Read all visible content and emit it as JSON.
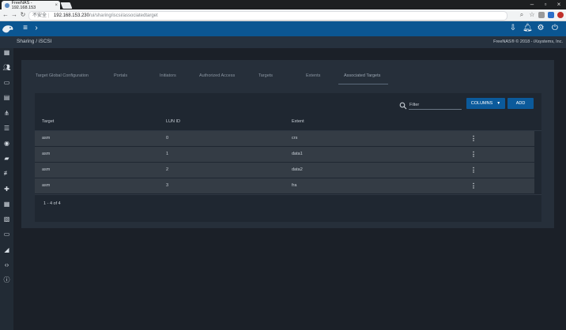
{
  "browser": {
    "tab_title": "FreeNAS - 192.168.153",
    "insecure_label": "不安全",
    "url_host": "192.168.153.230",
    "url_path": "/ui/sharing/iscsi/associatedtarget"
  },
  "breadcrumb": {
    "text": "Sharing  /  iSCSI"
  },
  "copyright": "FreeNAS® © 2018 - iXsystems, Inc.",
  "tabs": [
    {
      "label": "Target Global Configuration"
    },
    {
      "label": "Portals"
    },
    {
      "label": "Initiators"
    },
    {
      "label": "Authorized Access"
    },
    {
      "label": "Targets"
    },
    {
      "label": "Extents"
    },
    {
      "label": "Associated Targets"
    }
  ],
  "toolbar": {
    "filter_placeholder": "Filter",
    "columns_label": "COLUMNS",
    "add_label": "ADD"
  },
  "table": {
    "headers": [
      "Target",
      "LUN ID",
      "Extent"
    ],
    "rows": [
      {
        "target": "asm",
        "lun_id": "0",
        "extent": "crs"
      },
      {
        "target": "asm",
        "lun_id": "1",
        "extent": "data1"
      },
      {
        "target": "asm",
        "lun_id": "2",
        "extent": "data2"
      },
      {
        "target": "asm",
        "lun_id": "3",
        "extent": "fra"
      }
    ]
  },
  "pager": "1 - 4 of 4",
  "colors": {
    "header_blue": "#0b5692",
    "button_blue": "#0b5a9b",
    "row_bg": "#343c45"
  }
}
